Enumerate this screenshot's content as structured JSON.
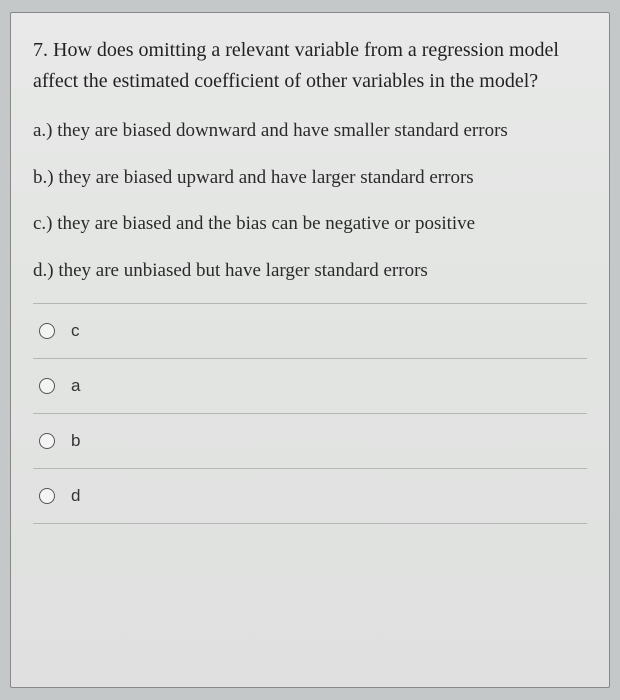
{
  "question": {
    "number": "7.",
    "text": "How does omitting a relevant variable from a regression model affect the estimated coefficient of other variables in the model?"
  },
  "options": [
    {
      "letter": "a.)",
      "text": "they are biased downward and have smaller standard errors"
    },
    {
      "letter": "b.)",
      "text": "they are biased upward and have larger standard errors"
    },
    {
      "letter": "c.)",
      "text": "they are biased and the bias can be negative or positive"
    },
    {
      "letter": "d.)",
      "text": "they are unbiased but have larger standard errors"
    }
  ],
  "answers": [
    {
      "label": "c"
    },
    {
      "label": "a"
    },
    {
      "label": "b"
    },
    {
      "label": "d"
    }
  ]
}
